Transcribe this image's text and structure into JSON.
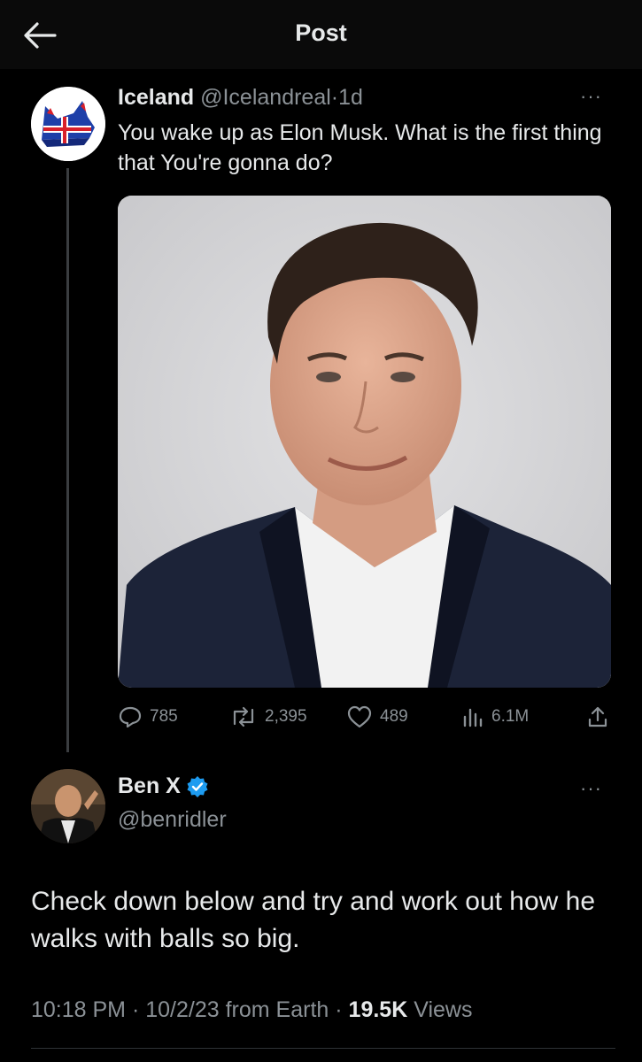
{
  "header": {
    "title": "Post"
  },
  "parent_tweet": {
    "name": "Iceland",
    "handle": "@Icelandreal",
    "separator": "·",
    "time": "1d",
    "more": "···",
    "text": "You wake up as Elon Musk. What is the first thing that You're gonna do?",
    "actions": {
      "replies": "785",
      "reposts": "2,395",
      "likes": "489",
      "views": "6.1M"
    }
  },
  "reply": {
    "name": "Ben X",
    "handle": "@benridler",
    "more": "···",
    "text": "Check down below and try and work out how he walks with balls so big.",
    "meta": {
      "time": "10:18 PM",
      "sep1": "·",
      "date": "10/2/23 from Earth",
      "sep2": "·",
      "views_count": "19.5K",
      "views_label": "Views"
    }
  },
  "colors": {
    "background": "#000000",
    "text": "#e7e9ea",
    "secondary": "#8b9196",
    "verified": "#1d9bf0"
  },
  "icons": [
    "back-arrow-icon",
    "more-icon",
    "reply-icon",
    "repost-icon",
    "like-icon",
    "views-icon",
    "share-icon",
    "verified-badge-icon"
  ]
}
